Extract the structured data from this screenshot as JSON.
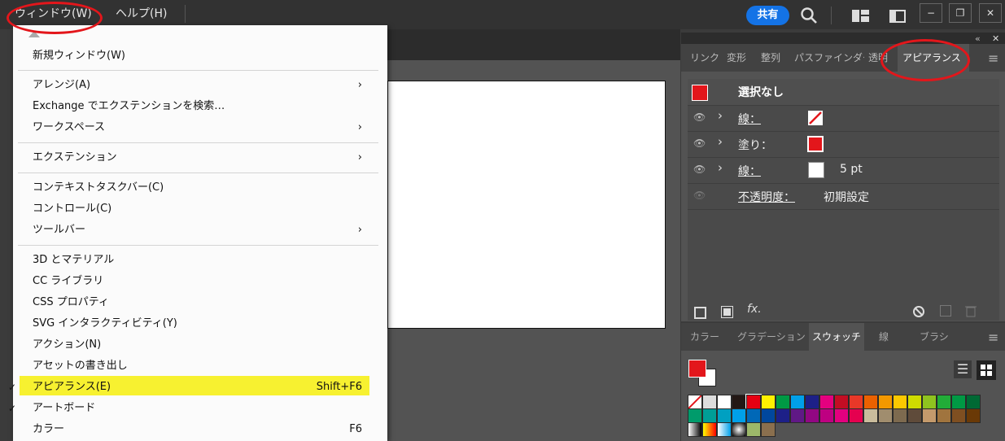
{
  "menubar": {
    "window_label": "ウィンドウ(W)",
    "help_label": "ヘルプ(H)",
    "share_label": "共有",
    "minimize": "−",
    "restore": "❐",
    "close": "✕"
  },
  "menu": {
    "items": [
      {
        "label": "新規ウィンドウ(W)"
      },
      {
        "label": "アレンジ(A)",
        "arrow": "›"
      },
      {
        "label": "Exchange でエクステンションを検索…"
      },
      {
        "label": "ワークスペース",
        "arrow": "›"
      },
      {
        "label": "エクステンション",
        "arrow": "›"
      },
      {
        "label": "コンテキストタスクバー(C)"
      },
      {
        "label": "コントロール(C)"
      },
      {
        "label": "ツールバー",
        "arrow": "›"
      },
      {
        "label": "3D とマテリアル"
      },
      {
        "label": "CC ライブラリ"
      },
      {
        "label": "CSS プロパティ"
      },
      {
        "label": "SVG インタラクティビティ(Y)"
      },
      {
        "label": "アクション(N)"
      },
      {
        "label": "アセットの書き出し"
      },
      {
        "label": "アピアランス(E)",
        "shortcut": "Shift+F6",
        "check": "✓"
      },
      {
        "label": "アートボード",
        "check": "✓"
      },
      {
        "label": "カラー",
        "shortcut": "F6"
      }
    ]
  },
  "top_panel": {
    "collapse": "«",
    "close": "✕",
    "menu": "≡",
    "tabs": [
      "リンク",
      "変形",
      "整列",
      "パスファインダー",
      "透明",
      "アピアランス"
    ],
    "appearance": {
      "header": "選択なし",
      "rows": [
        {
          "label": "線：",
          "expander": "›"
        },
        {
          "label": "塗り：",
          "expander": "›"
        },
        {
          "label": "線：",
          "value": "5 pt",
          "expander": "›"
        },
        {
          "label": "不透明度：",
          "value": "初期設定"
        }
      ],
      "fx": "fx."
    }
  },
  "bottom_panel": {
    "tabs": [
      "カラー",
      "グラデーション",
      "スウォッチ",
      "線",
      "ブラシ"
    ],
    "menu": "≡"
  },
  "colors": {
    "accent_red": "#e3161b",
    "highlight": "#f6f01a",
    "share_blue": "#1473e6"
  }
}
